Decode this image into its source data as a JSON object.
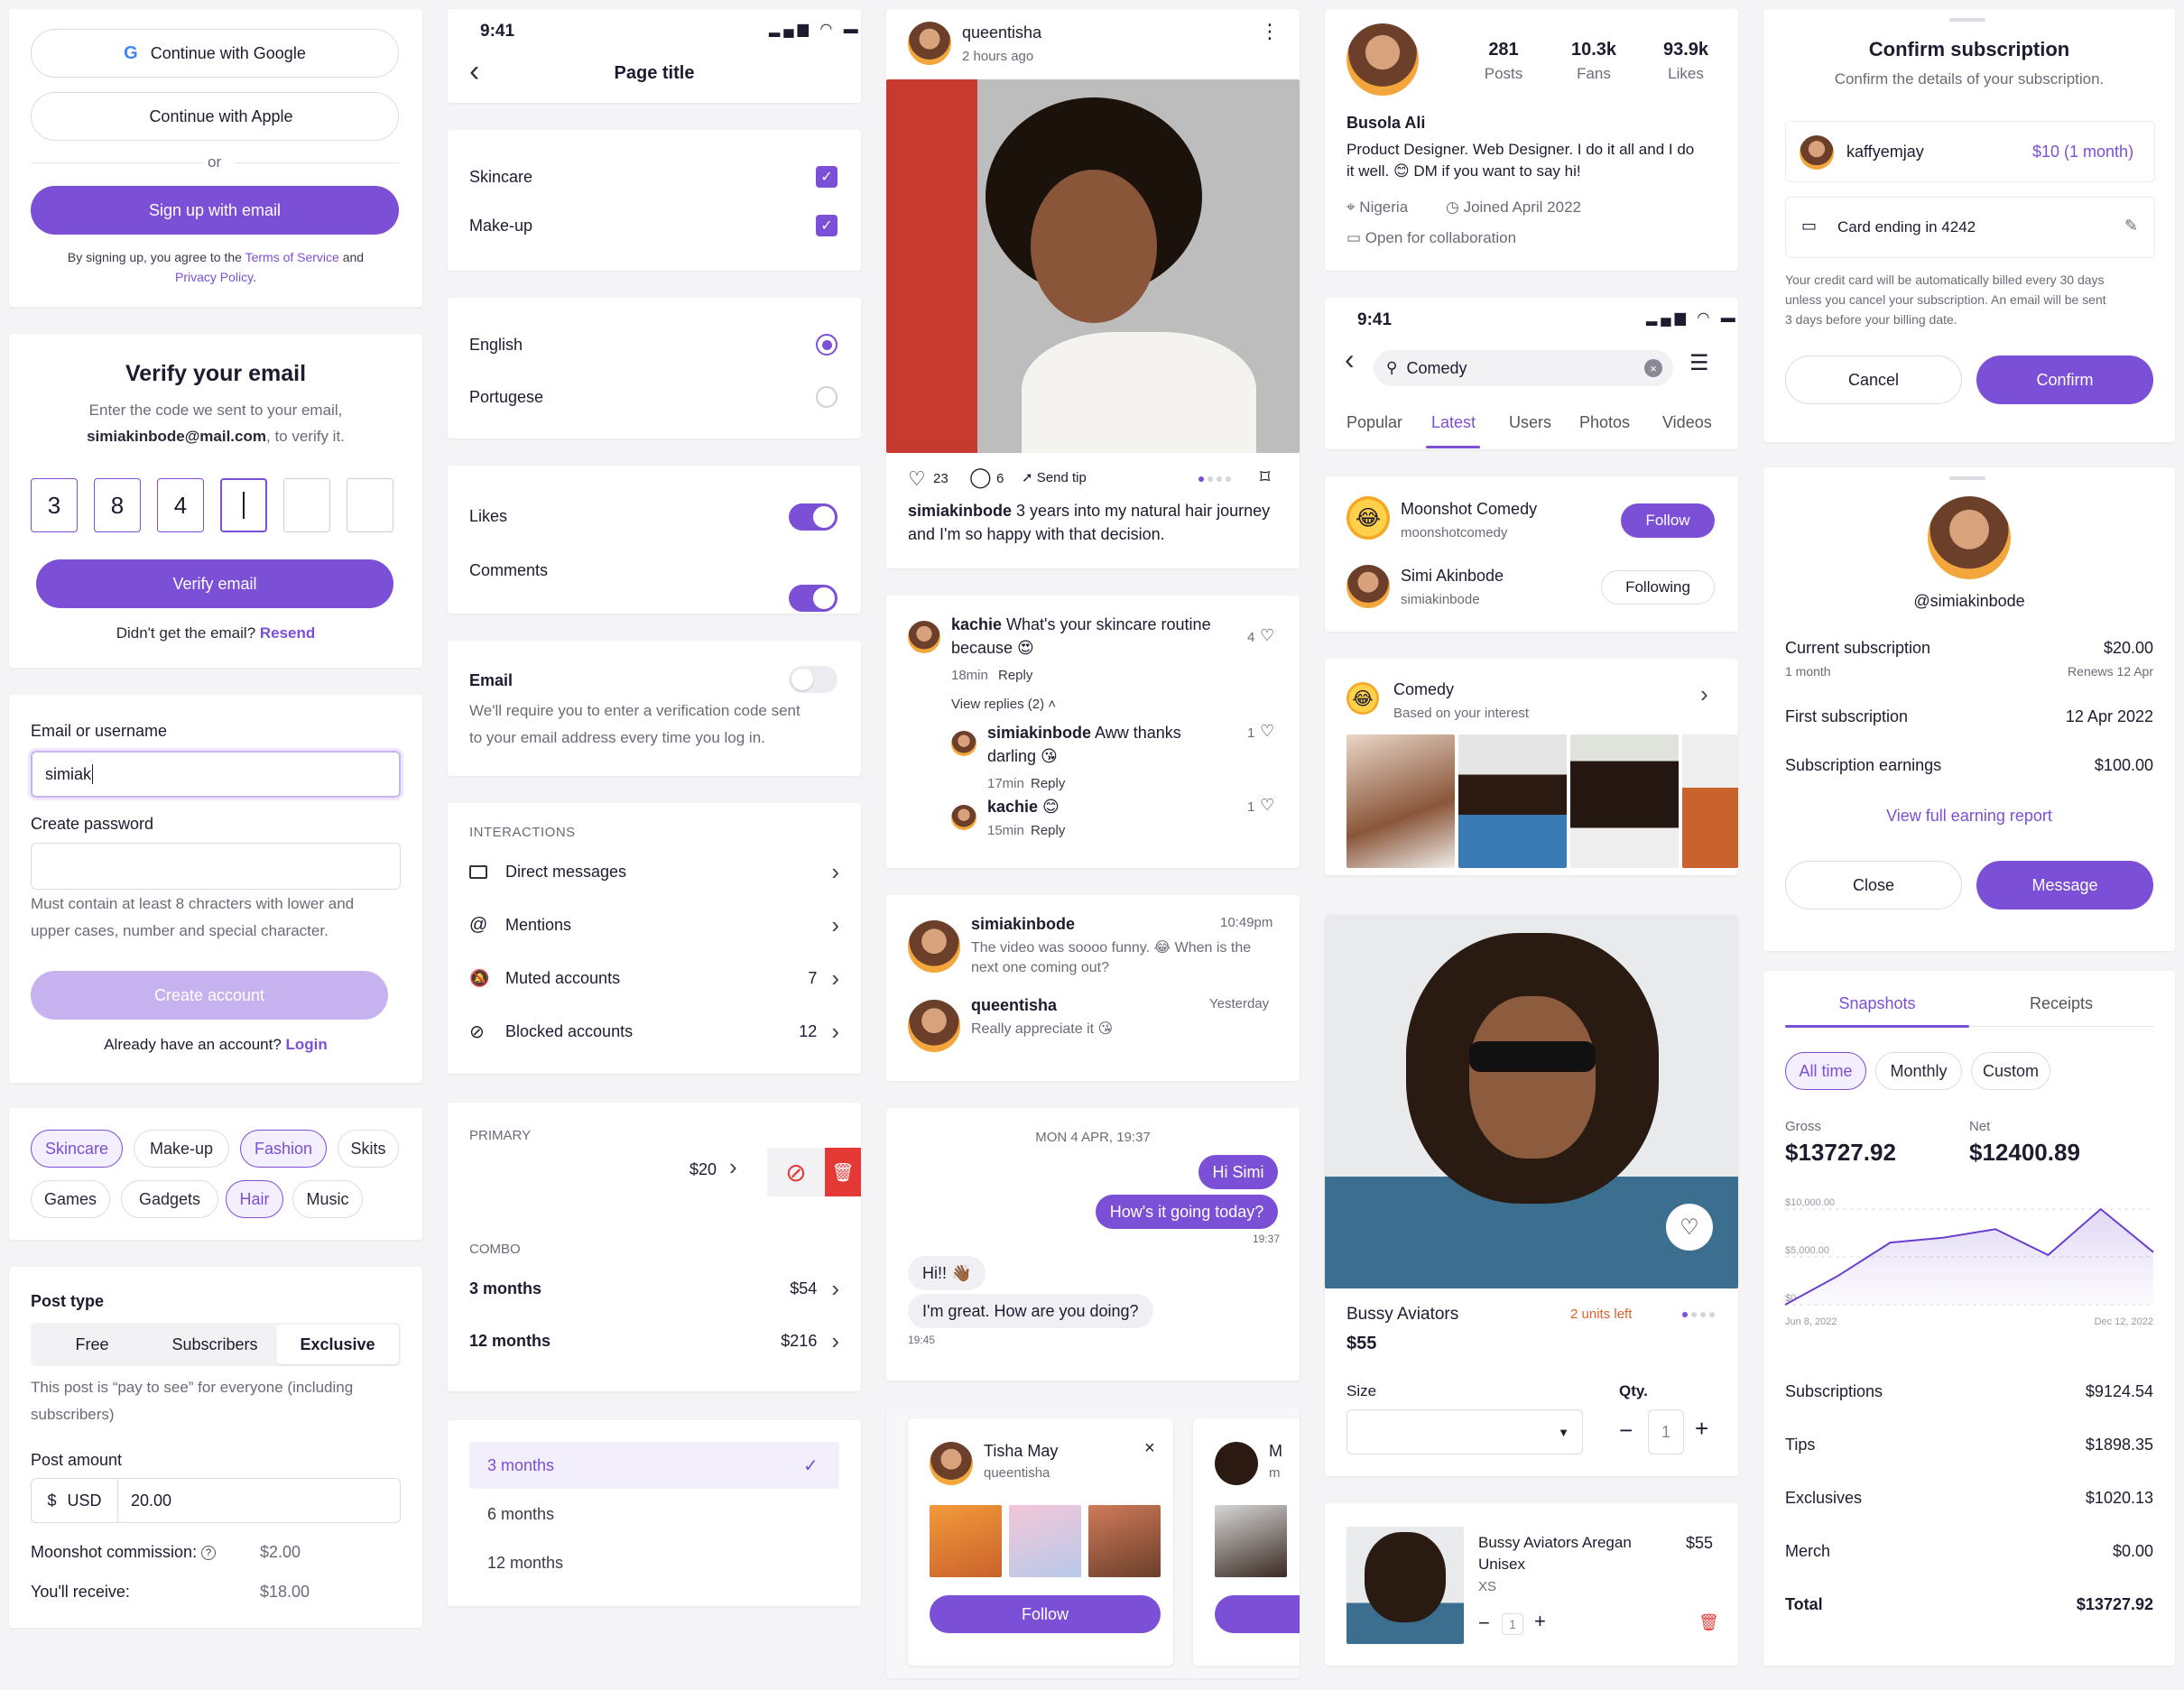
{
  "colors": {
    "accent": "#7b4fd6",
    "danger": "#e53935",
    "warn": "#e0602a"
  },
  "auth": {
    "google": "Continue with Google",
    "apple": "Continue with Apple",
    "or": "or",
    "signup_email": "Sign up with email",
    "terms_pre": "By signing up, you agree to the ",
    "terms": "Terms of Service",
    "terms_and": " and",
    "privacy": "Privacy Policy",
    "privacy_end": "."
  },
  "verify": {
    "title": "Verify your email",
    "line1": "Enter the code we sent to your email,",
    "email": "simiakinbode@mail.com",
    "line2": ", to verify it.",
    "digits": [
      "3",
      "8",
      "4"
    ],
    "button": "Verify email",
    "resend_pre": "Didn't get the email? ",
    "resend": "Resend"
  },
  "signup": {
    "email_label": "Email or username",
    "email_value": "simiak",
    "password_label": "Create password",
    "hint1": "Must contain at least 8 chracters with lower and",
    "hint2": "upper cases, number and special character.",
    "create": "Create account",
    "login_pre": "Already have an account? ",
    "login": "Login"
  },
  "interests": [
    "Skincare",
    "Make-up",
    "Fashion",
    "Skits",
    "Games",
    "Gadgets",
    "Hair",
    "Music"
  ],
  "post": {
    "type_label": "Post type",
    "types": [
      "Free",
      "Subscribers",
      "Exclusive"
    ],
    "desc1": "This post is “pay to see” for everyone (including",
    "desc2": "subscribers)",
    "amount_label": "Post amount",
    "currency_symbol": "$",
    "currency": "USD",
    "amount": "20.00",
    "commission_label": "Moonshot commission:",
    "commission": "$2.00",
    "receive_label": "You'll receive:",
    "receive": "$18.00"
  },
  "phone1": {
    "time": "9:41",
    "title": "Page title"
  },
  "settings": {
    "checks": [
      "Skincare",
      "Make-up"
    ],
    "radios": [
      "English",
      "Portugese"
    ],
    "toggles": [
      "Likes",
      "Comments"
    ],
    "email_title": "Email",
    "email_desc1": "We'll require you to enter a verification code sent",
    "email_desc2": "to your email address every time you log in.",
    "interactions_header": "INTERACTIONS",
    "interactions": [
      {
        "label": "Direct messages",
        "count": ""
      },
      {
        "label": "Mentions",
        "count": ""
      },
      {
        "label": "Muted accounts",
        "count": "7"
      },
      {
        "label": "Blocked accounts",
        "count": "12"
      }
    ],
    "primary_header": "PRIMARY",
    "primary_price": "$20",
    "combo_header": "COMBO",
    "combos": [
      {
        "label": "3 months",
        "price": "$54"
      },
      {
        "label": "12 months",
        "price": "$216"
      }
    ],
    "select_options": [
      "3 months",
      "6 months",
      "12 months"
    ]
  },
  "feed": {
    "user": "queentisha",
    "time": "2 hours ago",
    "likes": "23",
    "comments": "6",
    "tip": "Send tip",
    "caption_user": "simiakinbode",
    "caption": " 3 years into my natural hair journey",
    "caption2": "and I'm so happy with that decision."
  },
  "comments": [
    {
      "user": "kachie",
      "text": " What's your skincare routine",
      "text2": "because 😍",
      "time": "18min",
      "reply": "Reply",
      "likes": "4"
    },
    {
      "user": "simiakinbode",
      "text": " Aww thanks",
      "text2": "darling 😘",
      "time": "17min",
      "reply": "Reply",
      "likes": "1"
    },
    {
      "user": "kachie",
      "text": " 😊",
      "text2": "",
      "time": "15min",
      "reply": "Reply",
      "likes": "1"
    }
  ],
  "view_replies": "View replies (2)",
  "messages": [
    {
      "user": "simiakinbode",
      "time": "10:49pm",
      "text1": "The video was soooo funny. 😂 When is the",
      "text2": "next one coming out?"
    },
    {
      "user": "queentisha",
      "time": "Yesterday",
      "text1": "Really appreciate it 😘",
      "text2": ""
    }
  ],
  "chat": {
    "date": "MON 4 APR, 19:37",
    "out": [
      "Hi Simi",
      "How's it going today?"
    ],
    "out_time": "19:37",
    "in": [
      "Hi!! 👋🏾",
      "I'm great. How are you doing?"
    ],
    "in_time": "19:45"
  },
  "suggest": {
    "name": "Tisha May",
    "handle": "queentisha",
    "follow": "Follow",
    "next_initial": "M",
    "next_handle": "m"
  },
  "profile": {
    "posts": "281",
    "posts_label": "Posts",
    "fans": "10.3k",
    "fans_label": "Fans",
    "likes": "93.9k",
    "likes_label": "Likes",
    "name": "Busola Ali",
    "bio1": "Product Designer. Web Designer. I do it all and I do",
    "bio2": "it well. 😊 DM if you want to say hi!",
    "location": "Nigeria",
    "joined": "Joined April 2022",
    "collab": "Open for collaboration"
  },
  "search": {
    "time": "9:41",
    "query": "Comedy",
    "tabs": [
      "Popular",
      "Latest",
      "Users",
      "Photos",
      "Videos"
    ],
    "users": [
      {
        "name": "Moonshot Comedy",
        "handle": "moonshotcomedy",
        "action": "Follow"
      },
      {
        "name": "Simi Akinbode",
        "handle": "simiakinbode",
        "action": "Following"
      }
    ],
    "interest_title": "Comedy",
    "interest_sub": "Based on your interest"
  },
  "product": {
    "name": "Bussy Aviators",
    "units": "2 units left",
    "price": "$55",
    "size_label": "Size",
    "qty_label": "Qty.",
    "qty": "1"
  },
  "cart": {
    "name1": "Bussy Aviators Aregan",
    "name2": "Unisex",
    "size": "XS",
    "price": "$55",
    "qty": "1"
  },
  "confirm": {
    "title": "Confirm subscription",
    "subtitle": "Confirm the details of your subscription.",
    "user": "kaffyemjay",
    "price": "$10 (1 month)",
    "card": "Card ending in 4242",
    "note1": "Your credit card will be automatically billed every 30 days",
    "note2": "unless you cancel your subscription. An email will be sent",
    "note3": "3 days before your billing date.",
    "cancel": "Cancel",
    "confirm": "Confirm"
  },
  "subscriber": {
    "handle": "@simiakinbode",
    "current_label": "Current subscription",
    "current": "$20.00",
    "period": "1 month",
    "renews": "Renews 12 Apr",
    "first_label": "First subscription",
    "first": "12 Apr 2022",
    "earnings_label": "Subscription earnings",
    "earnings": "$100.00",
    "report": "View full earning report",
    "close": "Close",
    "message": "Message"
  },
  "earnings": {
    "tabs": [
      "Snapshots",
      "Receipts"
    ],
    "filters": [
      "All time",
      "Monthly",
      "Custom"
    ],
    "gross_label": "Gross",
    "gross": "$13727.92",
    "net_label": "Net",
    "net": "$12400.89",
    "rows": [
      {
        "label": "Subscriptions",
        "value": "$9124.54"
      },
      {
        "label": "Tips",
        "value": "$1898.35"
      },
      {
        "label": "Exclusives",
        "value": "$1020.13"
      },
      {
        "label": "Merch",
        "value": "$0.00"
      },
      {
        "label": "Total",
        "value": "$13727.92"
      }
    ]
  },
  "chart_data": {
    "type": "area",
    "y_ticks": [
      "$10,000.00",
      "$5,000.00",
      "$0"
    ],
    "x_ticks": [
      "Jun 8, 2022",
      "Dec 12, 2022"
    ],
    "ylim": [
      0,
      10000
    ],
    "values": [
      0,
      3000,
      6500,
      7000,
      7900,
      5200,
      10000,
      5500
    ],
    "grid": true
  }
}
